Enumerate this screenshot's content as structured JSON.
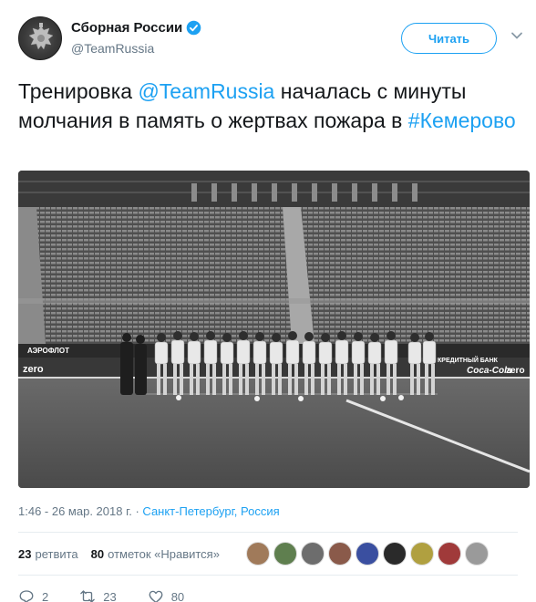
{
  "account": {
    "display_name": "Сборная России",
    "handle": "@TeamRussia"
  },
  "follow_button": {
    "label": "Читать"
  },
  "tweet": {
    "text_1": "Тренировка ",
    "mention": "@TeamRussia",
    "text_2": " началась с минуты молчания в память о жертвах пожара в ",
    "hashtag": "#Кемерово"
  },
  "meta": {
    "time": "1:46 - 26 мар. 2018 г. · ",
    "location": "Санкт-Петербург, Россия"
  },
  "stats": {
    "retweets_count": "23",
    "retweets_label": "ретвита",
    "likes_count": "80",
    "likes_label": "отметок «Нравится»"
  },
  "actions": {
    "reply_count": "2",
    "retweet_count": "23",
    "like_count": "80"
  },
  "photo": {
    "ad_banners": [
      "zero",
      "АЭРОФЛОТ",
      "КРЕДИТНЫЙ БАНК",
      "Coca-Cola",
      "zero"
    ]
  },
  "colors": {
    "accent": "#1da1f2",
    "text": "#14171a",
    "muted": "#657786"
  },
  "icons": [
    "verified-badge-icon",
    "chevron-down-icon",
    "reply-icon",
    "retweet-icon",
    "heart-icon"
  ]
}
